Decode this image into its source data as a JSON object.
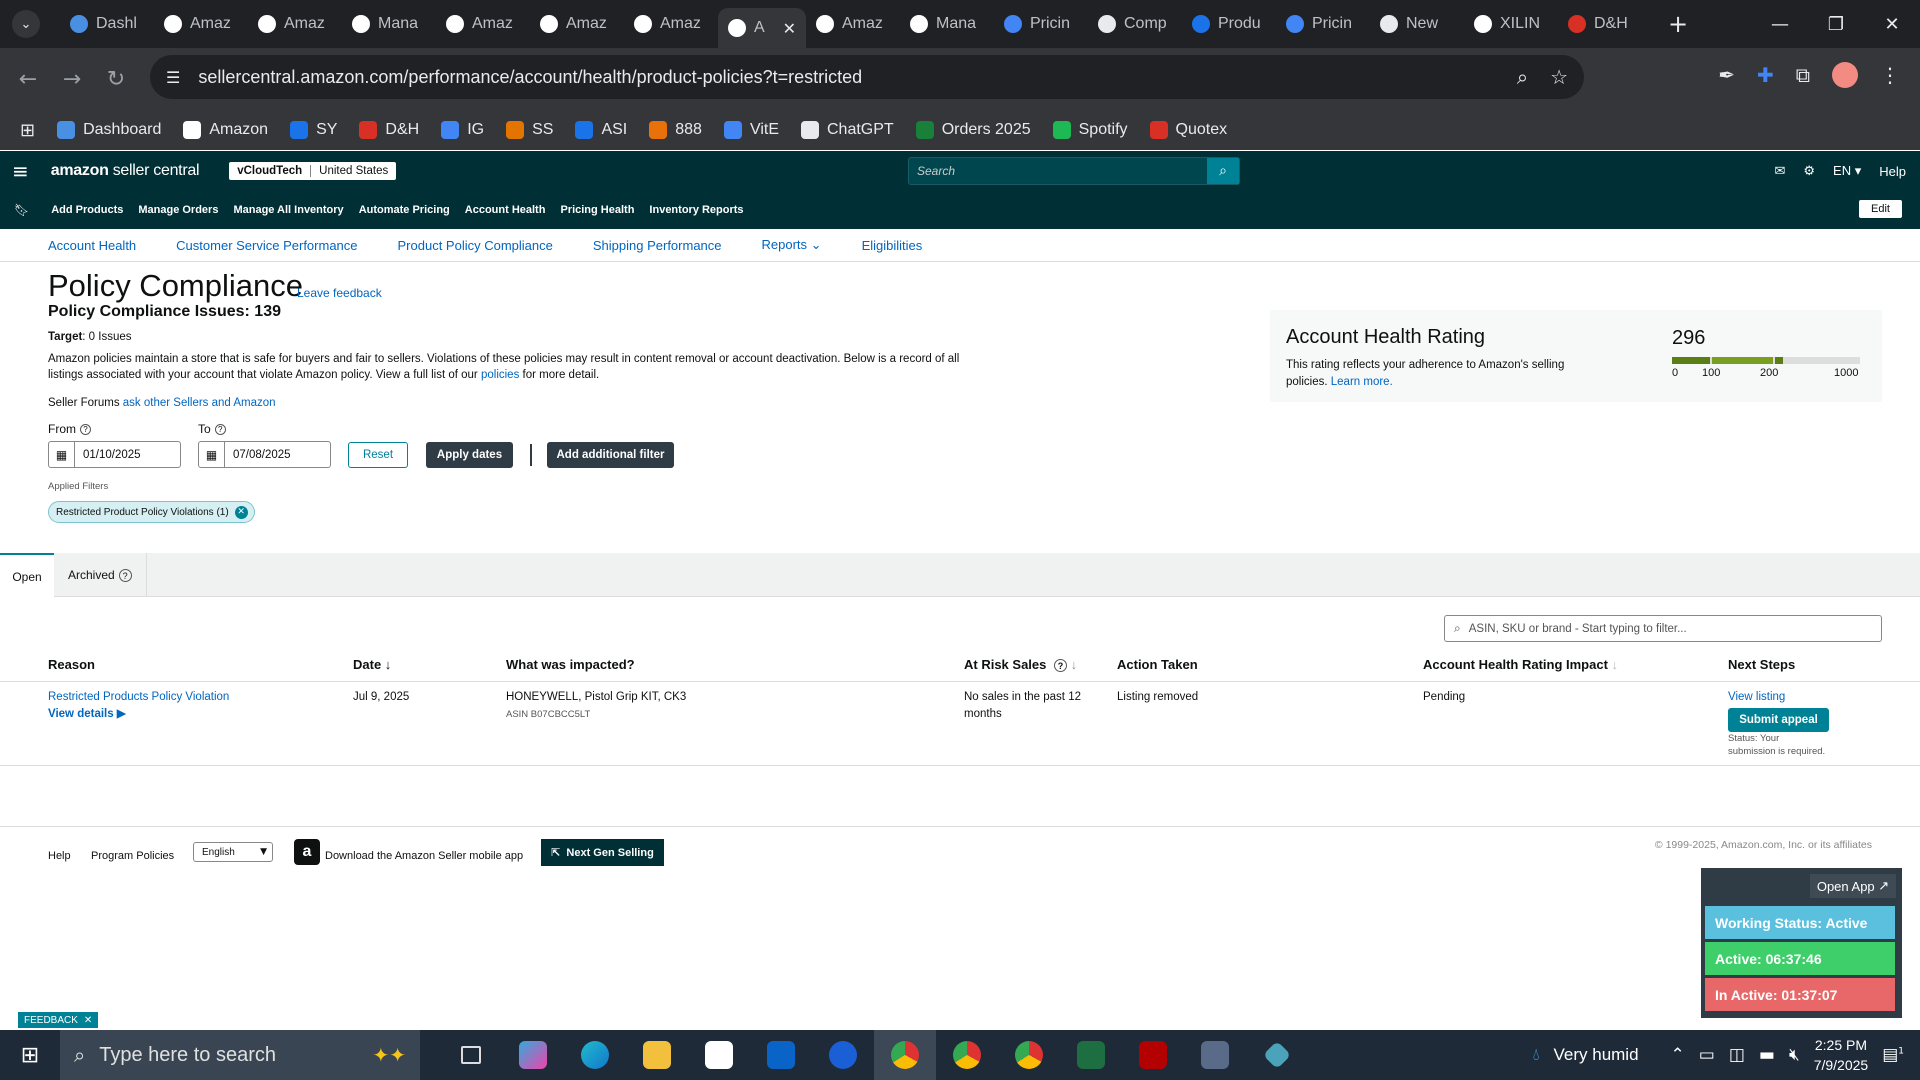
{
  "browser": {
    "tabs": [
      {
        "label": "Dashl",
        "icon": "dashboard-favicon",
        "color": "#4a90e2"
      },
      {
        "label": "Amaz",
        "icon": "amazon-favicon",
        "color": "#ffffff"
      },
      {
        "label": "Amaz",
        "icon": "amazon-favicon",
        "color": "#ffffff"
      },
      {
        "label": "Mana",
        "icon": "amazon-favicon",
        "color": "#ffffff"
      },
      {
        "label": "Amaz",
        "icon": "amazon-favicon",
        "color": "#ffffff"
      },
      {
        "label": "Amaz",
        "icon": "amazon-favicon",
        "color": "#ffffff"
      },
      {
        "label": "Amaz",
        "icon": "amazon-favicon",
        "color": "#ffffff"
      },
      {
        "label": "A",
        "icon": "amazon-favicon",
        "color": "#ffffff",
        "active": true
      },
      {
        "label": "Amaz",
        "icon": "amazon-favicon",
        "color": "#ffffff"
      },
      {
        "label": "Mana",
        "icon": "amazon-favicon",
        "color": "#ffffff"
      },
      {
        "label": "Pricin",
        "icon": "dollar-favicon",
        "color": "#4285f4"
      },
      {
        "label": "Comp",
        "icon": "chart-favicon",
        "color": "#e8eaed"
      },
      {
        "label": "Produ",
        "icon": "ec-favicon",
        "color": "#1a73e8"
      },
      {
        "label": "Pricin",
        "icon": "dollar-favicon",
        "color": "#4285f4"
      },
      {
        "label": "New",
        "icon": "chrome-favicon",
        "color": "#e8eaed"
      },
      {
        "label": "XILIN",
        "icon": "google-favicon",
        "color": "#ffffff"
      },
      {
        "label": "D&H",
        "icon": "dh-favicon",
        "color": "#d93025"
      }
    ],
    "url": "sellercentral.amazon.com/performance/account/health/product-policies?t=restricted",
    "bookmarks": [
      {
        "label": "Dashboard",
        "color": "#4a90e2"
      },
      {
        "label": "Amazon",
        "color": "#ffffff"
      },
      {
        "label": "SY",
        "color": "#1a73e8"
      },
      {
        "label": "D&H",
        "color": "#d93025"
      },
      {
        "label": "IG",
        "color": "#4285f4"
      },
      {
        "label": "SS",
        "color": "#e37400"
      },
      {
        "label": "ASI",
        "color": "#1a73e8"
      },
      {
        "label": "888",
        "color": "#e8710a"
      },
      {
        "label": "VitE",
        "color": "#4285f4"
      },
      {
        "label": "ChatGPT",
        "color": "#e8eaed"
      },
      {
        "label": "Orders 2025",
        "color": "#188038"
      },
      {
        "label": "Spotify",
        "color": "#1db954"
      },
      {
        "label": "Quotex",
        "color": "#d93025"
      }
    ]
  },
  "seller": {
    "logo_bold": "amazon",
    "logo_rest": " seller central",
    "store": "vCloudTech",
    "country": "United States",
    "search_placeholder": "Search",
    "lang": "EN",
    "help": "Help",
    "nav": [
      "Add Products",
      "Manage Orders",
      "Manage All Inventory",
      "Automate Pricing",
      "Account Health",
      "Pricing Health",
      "Inventory Reports"
    ],
    "edit": "Edit",
    "subnav": [
      "Account Health",
      "Customer Service Performance",
      "Product Policy Compliance",
      "Shipping Performance",
      "Reports",
      "Eligibilities"
    ]
  },
  "page": {
    "title": "Policy Compliance",
    "leave_feedback": "Leave feedback",
    "issues": "Policy Compliance Issues: 139",
    "target_label": "Target",
    "target_value": ": 0 Issues",
    "desc1": "Amazon policies maintain a store that is safe for buyers and fair to sellers. Violations of these policies may result in content removal or account deactivation. Below is a record of all listings associated with your account that violate Amazon policy. View a full list of our",
    "desc_link": "policies",
    "desc2": "for more detail.",
    "forums_prefix": "Seller Forums",
    "forums_link": "ask other Sellers and Amazon",
    "from_label": "From",
    "to_label": "To",
    "from_value": "01/10/2025",
    "to_value": "07/08/2025",
    "reset": "Reset",
    "apply": "Apply dates",
    "add_filter": "Add additional filter",
    "applied_filters": "Applied Filters",
    "chip": "Restricted Product Policy Violations (1)"
  },
  "ahr": {
    "title": "Account Health Rating",
    "desc": "This rating reflects your adherence to Amazon's selling policies.",
    "learn_more": "Learn more.",
    "score": "296",
    "ticks": [
      "0",
      "100",
      "200",
      "1000"
    ],
    "colors": {
      "bad": "#5a7d14",
      "good": "#7a9e1f",
      "rest": "#dddddd"
    }
  },
  "tabs": {
    "open": "Open",
    "archived": "Archived"
  },
  "filter_placeholder": "ASIN, SKU or brand - Start typing to filter...",
  "table": {
    "headers": [
      "Reason",
      "Date",
      "What was impacted?",
      "At Risk Sales",
      "Action Taken",
      "Account Health Rating Impact",
      "Next Steps"
    ],
    "row": {
      "reason": "Restricted Products Policy Violation",
      "view_details": "View details",
      "date": "Jul 9, 2025",
      "product": "HONEYWELL, Pistol Grip KIT, CK3",
      "asin": "ASIN B07CBCC5LT",
      "at_risk": "No sales in the past 12 months",
      "action": "Listing removed",
      "impact": "Pending",
      "view_listing": "View listing",
      "appeal": "Submit appeal",
      "status": "Status: Your submission is required."
    }
  },
  "footer": {
    "help": "Help",
    "program_policies": "Program Policies",
    "language": "English",
    "mobile": "Download the Amazon Seller mobile app",
    "next_gen": "Next Gen Selling",
    "copyright": "© 1999-2025, Amazon.com, Inc. or its affiliates"
  },
  "widget": {
    "open_app": "Open App",
    "working": "Working Status: Active",
    "active": "Active: 06:37:46",
    "inactive": "In Active: 01:37:07",
    "colors": {
      "working": "#5bc0de",
      "active": "#3ecf6a",
      "inactive": "#e8686a"
    }
  },
  "feedback": "FEEDBACK",
  "taskbar": {
    "search": "Type here to search",
    "weather": "Very humid",
    "time": "2:25 PM",
    "date": "7/9/2025",
    "notif": "1"
  }
}
